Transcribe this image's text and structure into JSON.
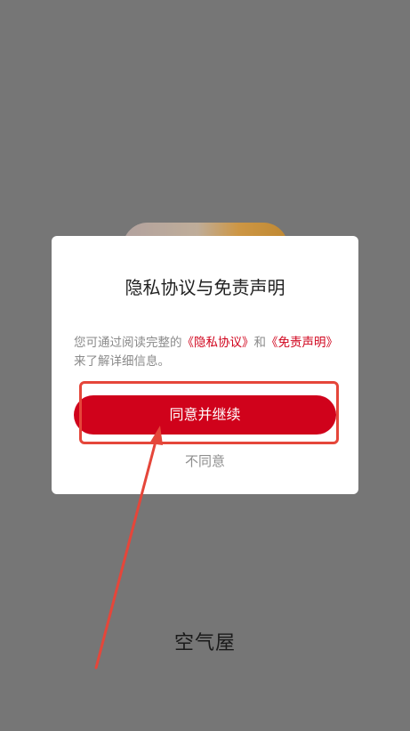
{
  "dialog": {
    "title": "隐私协议与免责声明",
    "body_prefix": "您可通过阅读完整的",
    "privacy_link": "《隐私协议》",
    "body_and": "和",
    "disclaimer_link": "《免责声明》",
    "body_suffix": "来了解详细信息。",
    "agree_button": "同意并继续",
    "disagree_button": "不同意"
  },
  "app": {
    "name": "空气屋"
  },
  "annotation": {
    "highlight_color": "#e5463a"
  },
  "colors": {
    "accent": "#d0021b",
    "overlay": "#767676"
  }
}
